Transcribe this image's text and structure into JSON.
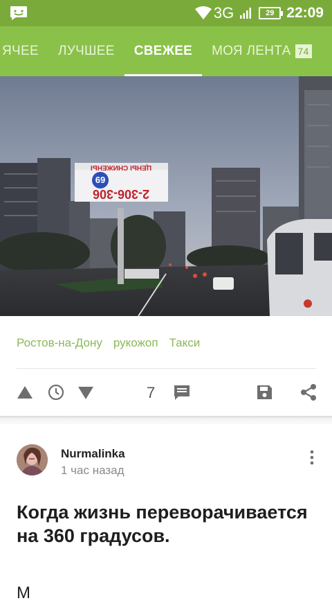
{
  "status_bar": {
    "network": "3G",
    "battery": "29",
    "time": "22:09",
    "icons": [
      "chat-notification-icon",
      "wifi-icon",
      "signal-icon",
      "battery-icon"
    ]
  },
  "tabs": [
    {
      "label": "ЯЧЕЕ",
      "active": false
    },
    {
      "label": "ЛУЧШЕЕ",
      "active": false
    },
    {
      "label": "СВЕЖЕЕ",
      "active": true
    },
    {
      "label": "МОЯ ЛЕНТА",
      "active": false,
      "badge": "74"
    }
  ],
  "post1": {
    "image": {
      "description_icon": "photo-image",
      "billboard_lines": [
        "ЦЕНЫ СНИЖЕНЫ",
        "69",
        "2-306-306"
      ]
    },
    "tags": [
      "Ростов-на-Дону",
      "рукожоп",
      "Такси"
    ],
    "comments_count": "7",
    "action_icons": [
      "upvote-icon",
      "clock-icon",
      "downvote-icon",
      "comment-icon",
      "save-icon",
      "share-icon"
    ]
  },
  "post2": {
    "author": "Nurmalinka",
    "time_ago": "1 час назад",
    "title": "Когда жизнь переворачивается на 360 градусов.",
    "text_start": "М"
  },
  "colors": {
    "status_bar": "#7aab3a",
    "tab_bar": "#8ac149",
    "tag_text": "#8ab85a"
  }
}
